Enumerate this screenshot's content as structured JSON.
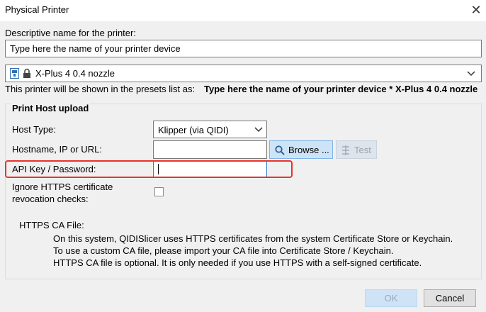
{
  "window": {
    "title": "Physical Printer"
  },
  "name_section": {
    "label": "Descriptive name for the printer:",
    "value": "Type here the name of your printer device"
  },
  "preset": {
    "selected": "X-Plus 4 0.4 nozzle",
    "shown_as_label": "This printer will be shown in the presets list as:",
    "shown_as_value": "Type here the name of your printer device * X-Plus 4 0.4 nozzle"
  },
  "host_upload": {
    "title": "Print Host upload",
    "host_type_label": "Host Type:",
    "host_type_value": "Klipper (via QIDI)",
    "hostname_label": "Hostname, IP or URL:",
    "hostname_value": "",
    "browse_label": "Browse ...",
    "test_label": "Test",
    "api_key_label": "API Key / Password:",
    "api_key_value": "",
    "ignore_https_label_1": "Ignore HTTPS certificate",
    "ignore_https_label_2": "revocation checks:",
    "ignore_https_checked": false,
    "https_ca_label": "HTTPS CA File:",
    "https_info_1": "On this system, QIDISlicer uses HTTPS certificates from the system Certificate Store or Keychain.",
    "https_info_2": "To use a custom CA file, please import your CA file into Certificate Store / Keychain.",
    "https_info_3": "HTTPS CA file is optional. It is only needed if you use HTTPS with a self-signed certificate."
  },
  "footer": {
    "ok_label": "OK",
    "cancel_label": "Cancel"
  },
  "colors": {
    "highlight": "#e8332c",
    "accent": "#cde4f7"
  }
}
